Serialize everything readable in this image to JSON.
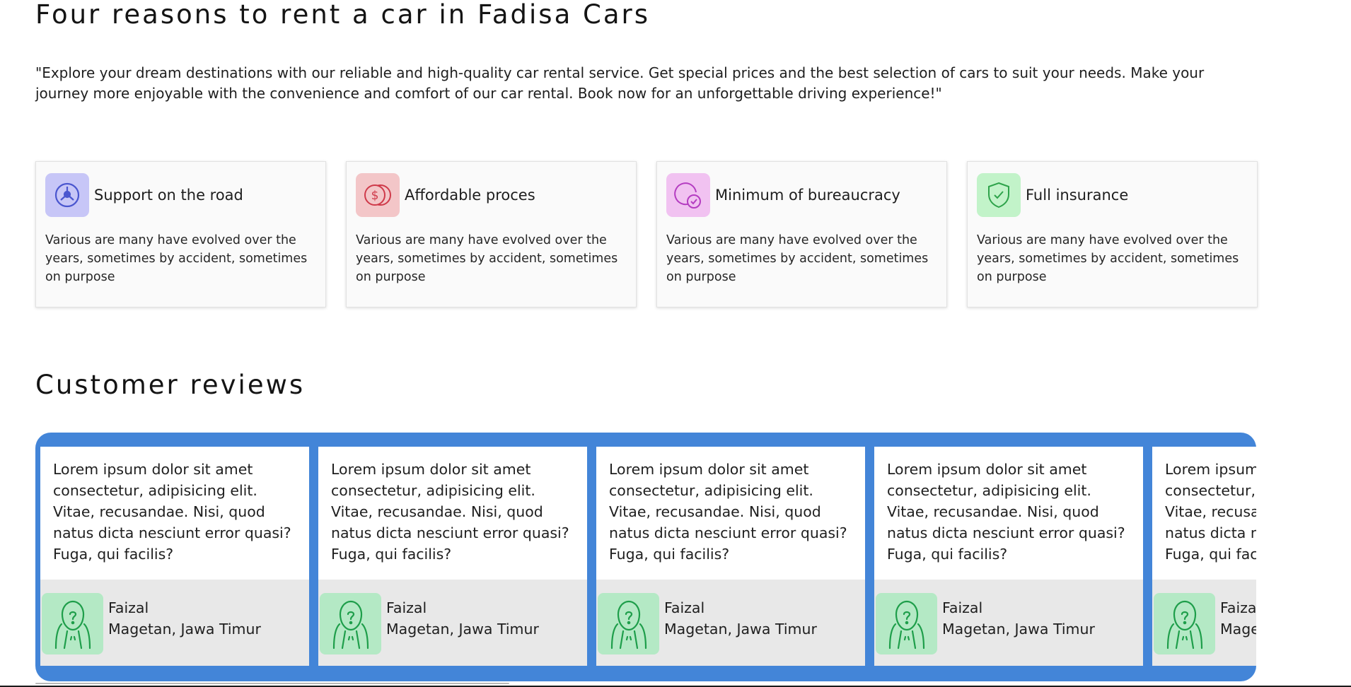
{
  "reasons": {
    "title": "Four reasons to rent a car in Fadisa Cars",
    "intro": "\"Explore your dream destinations with our reliable and high-quality car rental service. Get special prices and the best selection of cars to suit your needs. Make your journey more enjoyable with the convenience and comfort of our car rental. Book now for an unforgettable driving experience!\"",
    "cards": [
      {
        "icon": "support-icon",
        "title": "Support on the road",
        "description": "Various are many have evolved over the years, sometimes by accident, sometimes on purpose",
        "bg": "#c7c6f7",
        "color": "#4a56cf"
      },
      {
        "icon": "coins-icon",
        "title": "Affordable proces",
        "description": "Various are many have evolved over the years, sometimes by accident, sometimes on purpose",
        "bg": "#f3c6c8",
        "color": "#cf3a4a"
      },
      {
        "icon": "document-check-icon",
        "title": "Minimum of bureaucracy",
        "description": "Various are many have evolved over the years, sometimes by accident, sometimes on purpose",
        "bg": "#f1c2f1",
        "color": "#b43cc1"
      },
      {
        "icon": "shield-check-icon",
        "title": "Full insurance",
        "description": "Various are many have evolved over the years, sometimes by accident, sometimes on purpose",
        "bg": "#c2f3c9",
        "color": "#2ea34a"
      }
    ]
  },
  "reviews": {
    "title": "Customer reviews",
    "accent_color": "#4385d8",
    "items": [
      {
        "text": "Lorem ipsum dolor sit amet consectetur, adipisicing elit. Vitae, recusandae. Nisi, quod natus dicta nesciunt error quasi? Fuga, qui facilis?",
        "name": "Faizal",
        "location": "Magetan, Jawa Timur"
      },
      {
        "text": "Lorem ipsum dolor sit amet consectetur, adipisicing elit. Vitae, recusandae. Nisi, quod natus dicta nesciunt error quasi? Fuga, qui facilis?",
        "name": "Faizal",
        "location": "Magetan, Jawa Timur"
      },
      {
        "text": "Lorem ipsum dolor sit amet consectetur, adipisicing elit. Vitae, recusandae. Nisi, quod natus dicta nesciunt error quasi? Fuga, qui facilis?",
        "name": "Faizal",
        "location": "Magetan, Jawa Timur"
      },
      {
        "text": "Lorem ipsum dolor sit amet consectetur, adipisicing elit. Vitae, recusandae. Nisi, quod natus dicta nesciunt error quasi? Fuga, qui facilis?",
        "name": "Faizal",
        "location": "Magetan, Jawa Timur"
      },
      {
        "text": "Lorem ipsum dolor sit amet consectetur, adipisicing elit. Vitae, recusandae. Nisi, quod natus dicta nesciunt error quasi? Fuga, qui facilis?",
        "name": "Faizal",
        "location": "Magetan, Jawa Timur"
      }
    ]
  }
}
